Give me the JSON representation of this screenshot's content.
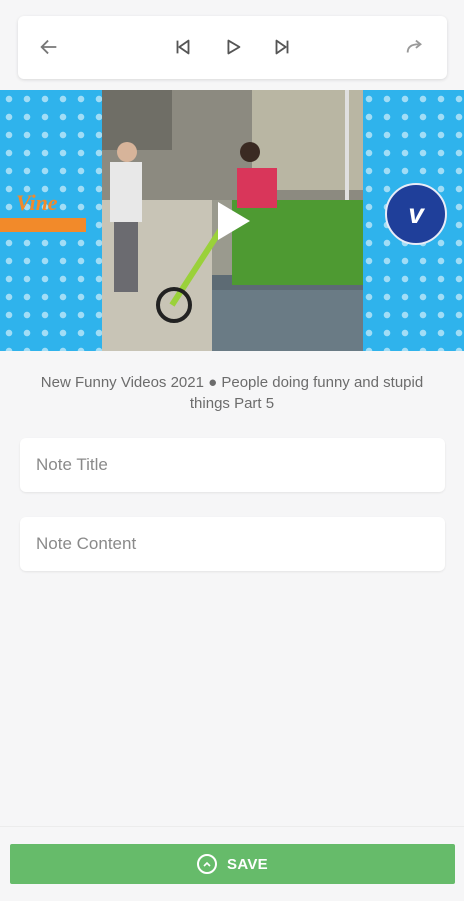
{
  "toolbar": {
    "back_icon": "arrow-left-icon",
    "prev_icon": "skip-previous-icon",
    "play_icon": "play-icon",
    "next_icon": "skip-next-icon",
    "share_icon": "share-arrow-icon"
  },
  "video": {
    "logo_text": "Vine",
    "badge_text": "v",
    "title": "New Funny Videos 2021 ● People doing funny and stupid things Part 5"
  },
  "note_title": {
    "placeholder": "Note Title",
    "value": ""
  },
  "note_content": {
    "placeholder": "Note Content",
    "value": ""
  },
  "save_button": {
    "label": "SAVE",
    "icon": "save-icon"
  },
  "colors": {
    "accent_green": "#66bb6a",
    "video_blue": "#2fb3ec",
    "badge_navy": "#1f3f9a"
  }
}
